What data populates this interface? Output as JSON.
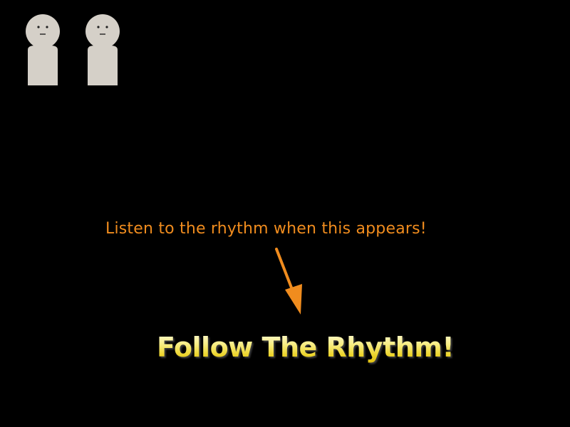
{
  "hint": {
    "text": "Listen to the rhythm when this appears!",
    "color": "#f08c1e"
  },
  "cue": {
    "text": "Follow The Rhythm!",
    "color": "#f3e14a"
  },
  "characters": [
    {
      "icon": "neutral-face-figure-icon",
      "color": "#d5d0c8"
    },
    {
      "icon": "neutral-face-figure-icon",
      "color": "#d5d0c8"
    }
  ],
  "pointer": {
    "icon": "arrow-down-icon",
    "color": "#f08c1e"
  }
}
